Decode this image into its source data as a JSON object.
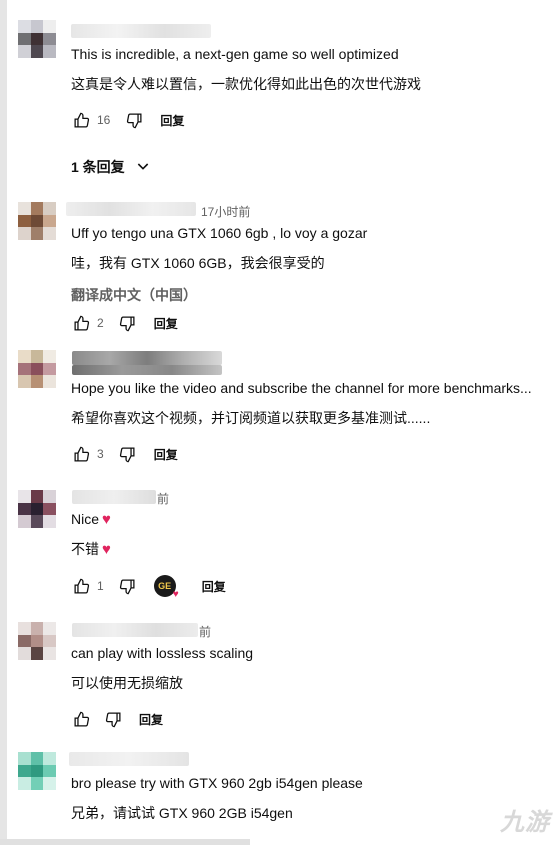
{
  "comments": [
    {
      "timestamp": "",
      "text": "This is incredible, a next-gen game so well optimized",
      "translation": "这真是令人难以置信，一款优化得如此出色的次世代游戏",
      "likes": "16",
      "reply_label": "回复"
    },
    {
      "timestamp": "17小时前",
      "text": "Uff yo tengo una GTX 1060 6gb , lo voy a gozar",
      "translation": "哇，我有 GTX 1060 6GB，我会很享受的",
      "translate_link": "翻译成中文（中国）",
      "likes": "2",
      "reply_label": "回复"
    },
    {
      "timestamp": "",
      "text": "Hope you like the video and subscribe the channel for more benchmarks...",
      "translation": "希望你喜欢这个视频，并订阅频道以获取更多基准测试......",
      "likes": "3",
      "reply_label": "回复"
    },
    {
      "timestamp": "前",
      "text": "Nice",
      "translation": "不错",
      "likes": "1",
      "reply_label": "回复",
      "creator_heart_label": "GE"
    },
    {
      "timestamp": "前",
      "text": "can play with lossless scaling",
      "translation": "可以使用无损缩放",
      "likes": "",
      "reply_label": "回复"
    },
    {
      "timestamp": "",
      "text": "bro please try with GTX 960 2gb i54gen please",
      "translation": "兄弟，请试试 GTX 960 2GB i54gen"
    }
  ],
  "replies_toggle": "1 条回复",
  "watermark": "九游",
  "icons": [
    "thumb-up-icon",
    "thumb-down-icon",
    "chevron-down-icon",
    "heart-icon"
  ]
}
